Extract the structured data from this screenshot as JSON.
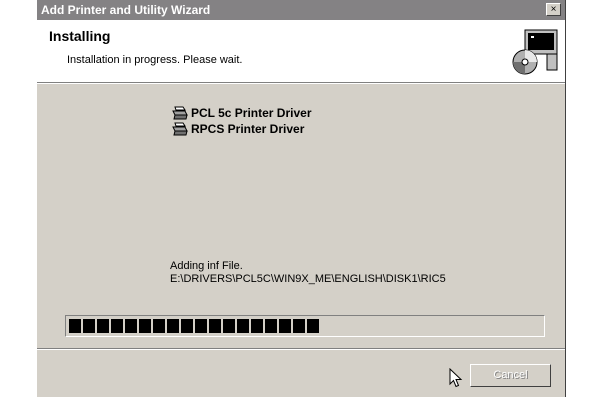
{
  "window": {
    "title": "Add Printer and Utility Wizard",
    "close_label": "×"
  },
  "header": {
    "title": "Installing",
    "subtitle": "Installation in progress. Please wait.",
    "icon": "computer-cd-icon"
  },
  "drivers": [
    {
      "label": "PCL 5c Printer Driver",
      "icon": "printer-icon"
    },
    {
      "label": "RPCS Printer Driver",
      "icon": "printer-icon"
    }
  ],
  "status": {
    "action": "Adding inf File.",
    "path": "E:\\DRIVERS\\PCL5C\\WIN9X_ME\\ENGLISH\\DISK1\\RIC5"
  },
  "progress": {
    "fraction": 0.525,
    "filled_blocks": 18,
    "total_blocks": 34
  },
  "buttons": {
    "cancel_label": "Cancel"
  },
  "colors": {
    "face": "#d4d0c8",
    "titlebar_inactive": "#848284",
    "progress_block": "#000000"
  }
}
